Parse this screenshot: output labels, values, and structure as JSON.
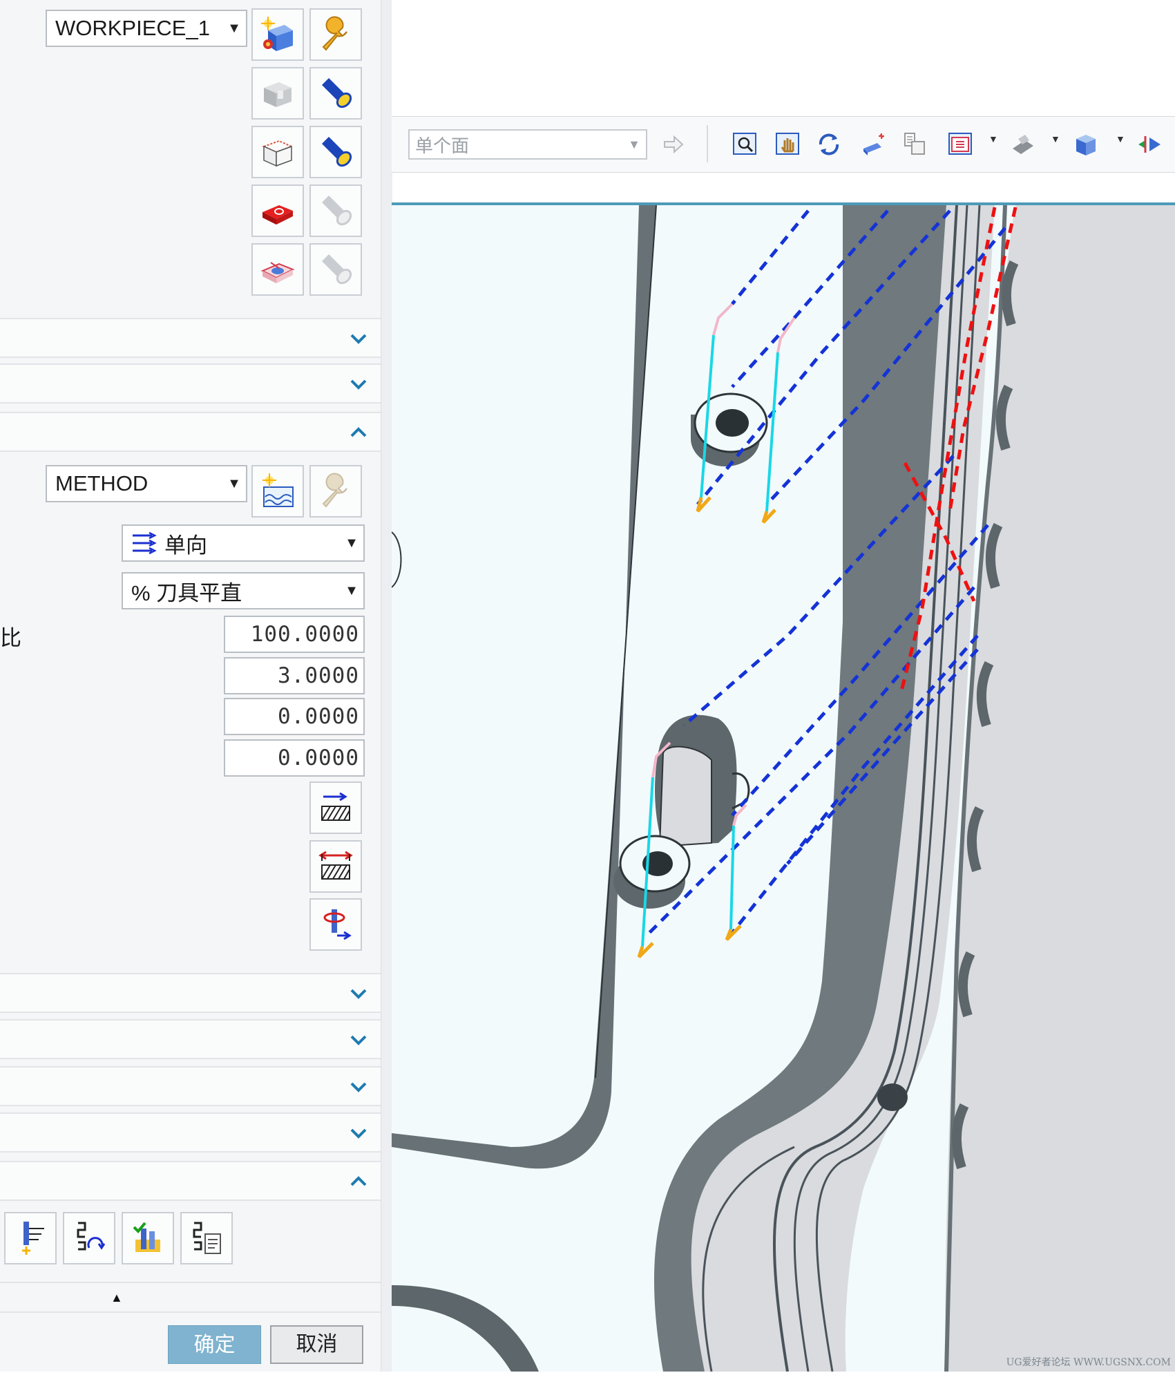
{
  "panel": {
    "geometry_dropdown": "WORKPIECE_1",
    "method_dropdown": "METHOD",
    "cut_pattern": "单向",
    "stepover_type": "% 刀具平直",
    "percent_label": "比",
    "values": [
      "100.0000",
      "3.0000",
      "0.0000",
      "0.0000"
    ],
    "ok_label": "确定",
    "cancel_label": "取消"
  },
  "toolbar": {
    "filter_value": "单个面"
  },
  "watermark": "UG爱好者论坛 WWW.UGSNX.COM",
  "colors": {
    "accent": "#4d9ab9",
    "ok_button": "#7fb3cf",
    "toolpath_blue": "#1433d6",
    "toolpath_red": "#ee1111",
    "toolpath_cyan": "#19d7e6",
    "model_face": "#f2fafc",
    "model_wall": "#677176"
  }
}
